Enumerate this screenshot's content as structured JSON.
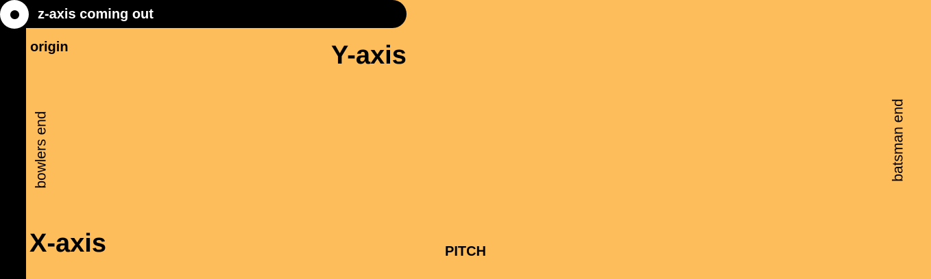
{
  "labels": {
    "z_axis": "z-axis coming out",
    "origin": "origin",
    "y_axis": "Y-axis",
    "x_axis": "X-axis",
    "pitch": "PITCH",
    "bowlers_end": "bowlers end",
    "batsman_end": "batsman end"
  },
  "colors": {
    "pitch_fill": "#FDBD5B",
    "axis": "#000000",
    "z_icon": "#FFFFFF"
  },
  "icons": {
    "z_axis": "z-axis-out-of-page-icon"
  }
}
